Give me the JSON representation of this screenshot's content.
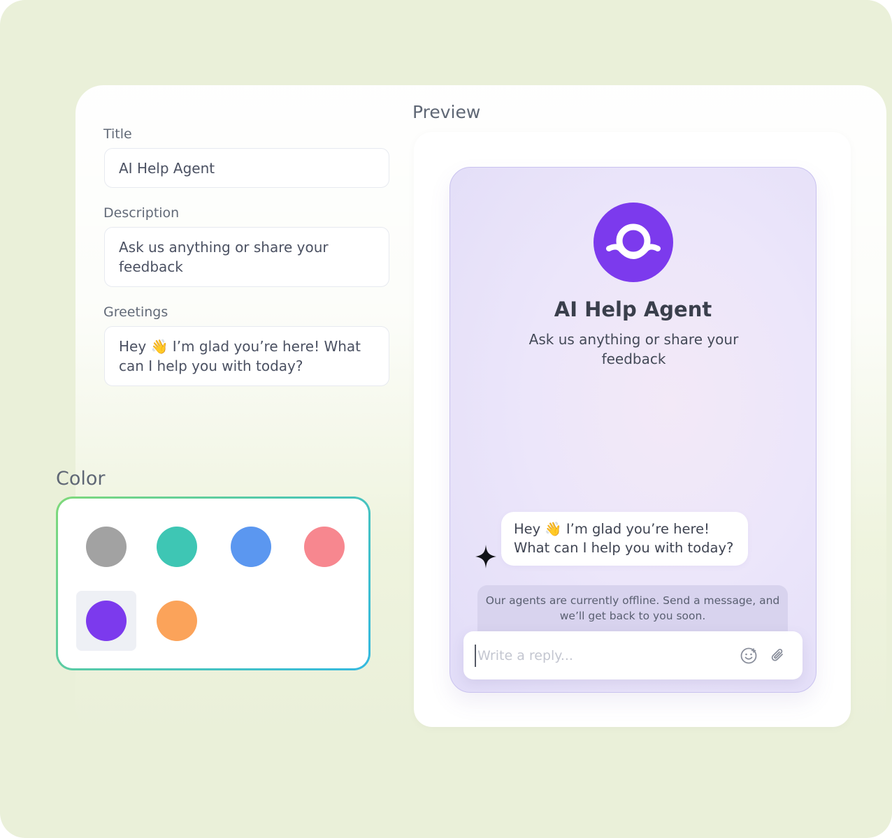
{
  "form": {
    "title_label": "Title",
    "title_value": "AI Help Agent",
    "description_label": "Description",
    "description_value": "Ask us anything or share your feedback",
    "greetings_label": "Greetings",
    "greetings_value": "Hey 👋 I’m glad you’re here! What can I help you with today?"
  },
  "color": {
    "label": "Color",
    "selected": "purple",
    "swatches": [
      {
        "name": "gray",
        "hex": "#a2a2a2"
      },
      {
        "name": "teal",
        "hex": "#3ec6b4"
      },
      {
        "name": "blue",
        "hex": "#5b97f0"
      },
      {
        "name": "pink",
        "hex": "#f7878f"
      },
      {
        "name": "purple",
        "hex": "#7c3aed"
      },
      {
        "name": "orange",
        "hex": "#fba35a"
      }
    ]
  },
  "preview": {
    "label": "Preview",
    "agent_title": "AI Help Agent",
    "agent_description": "Ask us anything or share your feedback",
    "greeting_message": "Hey 👋 I’m glad you’re here! What can I help you with today?",
    "offline_notice": "Our agents are currently offline. Send a message, and we’ll get back to you soon.",
    "reply_placeholder": "Write a reply...",
    "accent_color": "#7c3aed",
    "icons": [
      "agent-logo-icon",
      "sparkle-icon",
      "emoji-icon",
      "paperclip-icon"
    ]
  }
}
